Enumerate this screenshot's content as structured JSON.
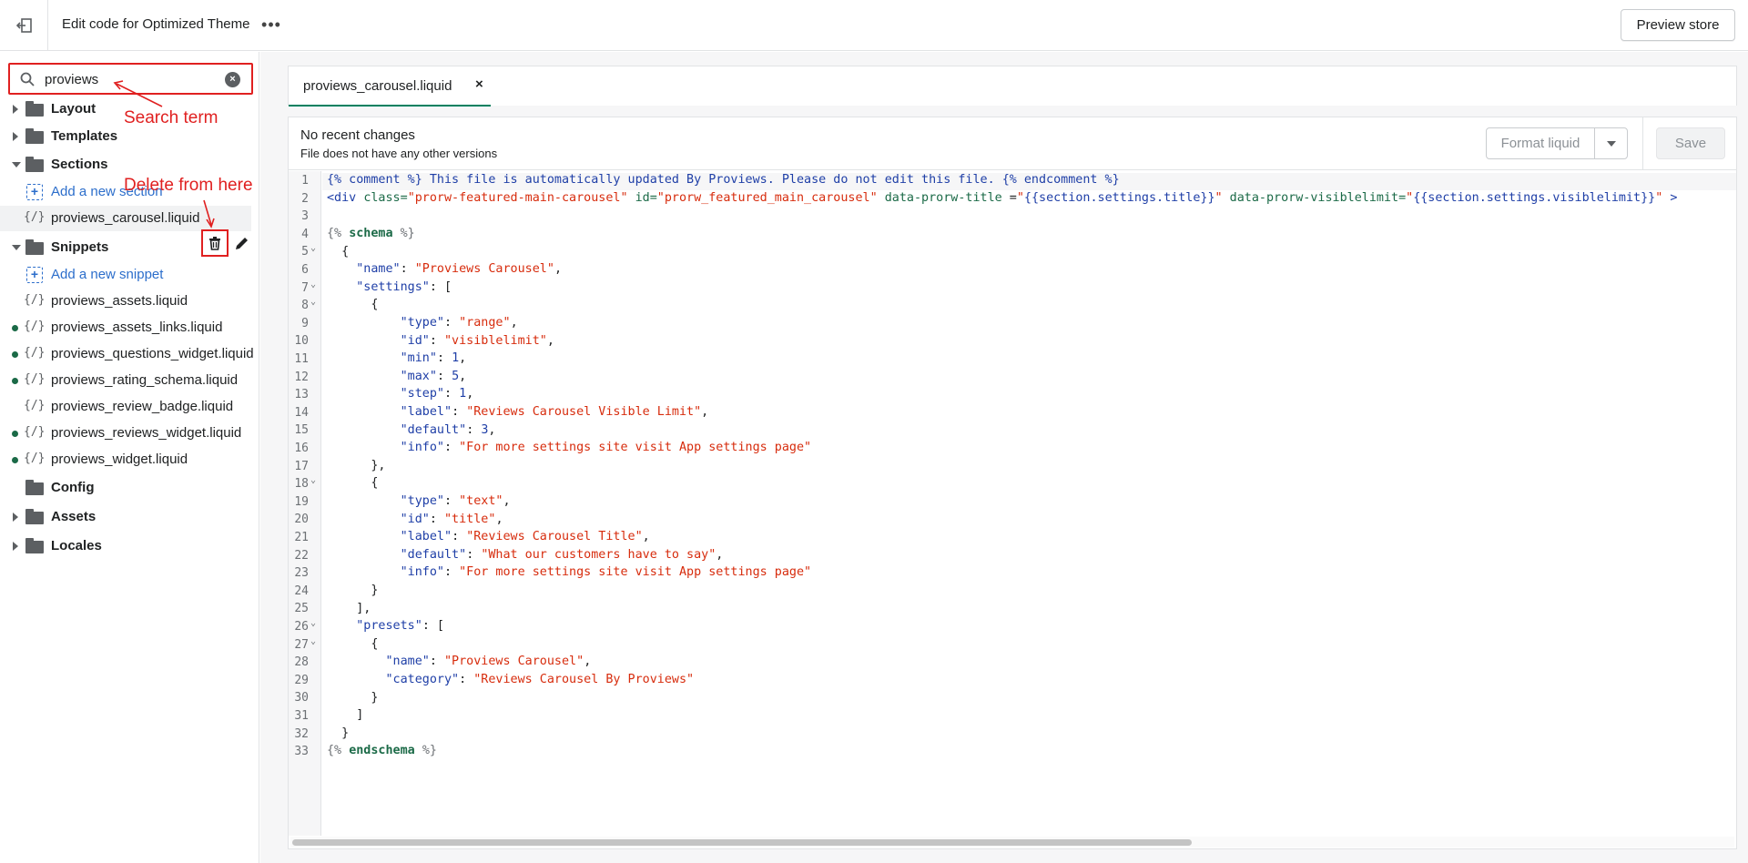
{
  "topbar": {
    "title": "Edit code for Optimized Theme",
    "more_label": "•••",
    "preview_label": "Preview store"
  },
  "sidebar": {
    "search_value": "proviews",
    "tree": [
      {
        "type": "folder",
        "label": "Layout",
        "expanded": false
      },
      {
        "type": "folder",
        "label": "Templates",
        "expanded": false
      },
      {
        "type": "folder",
        "label": "Sections",
        "expanded": true
      },
      {
        "type": "add",
        "label": "Add a new section"
      },
      {
        "type": "file",
        "label": "proviews_carousel.liquid",
        "modified": false,
        "selected": true
      },
      {
        "type": "folder",
        "label": "Snippets",
        "expanded": true
      },
      {
        "type": "add",
        "label": "Add a new snippet"
      },
      {
        "type": "file",
        "label": "proviews_assets.liquid",
        "modified": false
      },
      {
        "type": "file",
        "label": "proviews_assets_links.liquid",
        "modified": true
      },
      {
        "type": "file",
        "label": "proviews_questions_widget.liquid",
        "modified": true
      },
      {
        "type": "file",
        "label": "proviews_rating_schema.liquid",
        "modified": true
      },
      {
        "type": "file",
        "label": "proviews_review_badge.liquid",
        "modified": false
      },
      {
        "type": "file",
        "label": "proviews_reviews_widget.liquid",
        "modified": true
      },
      {
        "type": "file",
        "label": "proviews_widget.liquid",
        "modified": true
      },
      {
        "type": "folder",
        "label": "Config",
        "expanded": false,
        "no_caret": true
      },
      {
        "type": "folder",
        "label": "Assets",
        "expanded": false
      },
      {
        "type": "folder",
        "label": "Locales",
        "expanded": false
      }
    ]
  },
  "annotations": {
    "search_term": "Search term",
    "delete_from_here": "Delete from here"
  },
  "editor": {
    "tab_label": "proviews_carousel.liquid",
    "tab_close": "×",
    "status_title": "No recent changes",
    "status_sub": "File does not have any other versions",
    "format_label": "Format liquid",
    "save_label": "Save",
    "line_numbers": [
      "1",
      "2",
      "3",
      "4",
      "5",
      "6",
      "7",
      "8",
      "9",
      "10",
      "11",
      "12",
      "13",
      "14",
      "15",
      "16",
      "17",
      "18",
      "19",
      "20",
      "21",
      "22",
      "23",
      "24",
      "25",
      "26",
      "27",
      "28",
      "29",
      "30",
      "31",
      "32",
      "33"
    ]
  },
  "colors": {
    "accent_green": "#008060",
    "annotation_red": "#e02020",
    "link_blue": "#2c6ecb",
    "string_red": "#d72c0d"
  }
}
